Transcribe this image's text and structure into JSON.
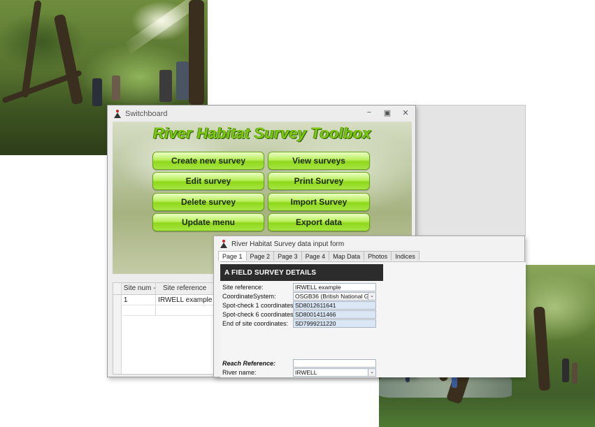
{
  "switchboard": {
    "title": "Switchboard",
    "heading": "River Habitat Survey Toolbox",
    "buttons": {
      "create": "Create new survey",
      "view": "View surveys",
      "edit": "Edit  survey",
      "print": "Print Survey",
      "delete": "Delete survey",
      "import": "Import Survey",
      "update": "Update menu",
      "export": "Export data"
    },
    "window_controls": {
      "minimize": "−",
      "restore": "▣",
      "close": "✕"
    },
    "datasheet": {
      "columns": [
        "Site num -",
        "Site reference"
      ],
      "rows": [
        {
          "site_num": "1",
          "site_reference": "IRWELL example"
        }
      ],
      "new_row_marker": "✱"
    }
  },
  "data_form": {
    "title": "River Habitat Survey data input form",
    "tabs": [
      "Page 1",
      "Page 2",
      "Page 3",
      "Page 4",
      "Map Data",
      "Photos",
      "Indices"
    ],
    "active_tab": "Page 1",
    "section_header": "A  FIELD SURVEY DETAILS",
    "fields": {
      "site_reference": {
        "label": "Site reference:",
        "value": "IRWELL example"
      },
      "coordinate_system": {
        "label": "CoordinateSystem:",
        "value": "OSGB36 (British National Gr"
      },
      "spot_check_1": {
        "label": "Spot-check 1 coordinates:",
        "value": "SD8012611641"
      },
      "spot_check_6": {
        "label": "Spot-check 6 coordinates:",
        "value": "SD8001411466"
      },
      "end_of_site": {
        "label": "End of site coordinates:",
        "value": "SD7999211220"
      },
      "reach_reference": {
        "label": "Reach Reference:",
        "value": ""
      },
      "river_name": {
        "label": "River name:",
        "value": "IRWELL"
      }
    },
    "combo_arrow": "⌄"
  },
  "colors": {
    "toolbox_green": "#7cc80e",
    "button_green": "#a6e543",
    "section_header": "#2c2c2c"
  }
}
